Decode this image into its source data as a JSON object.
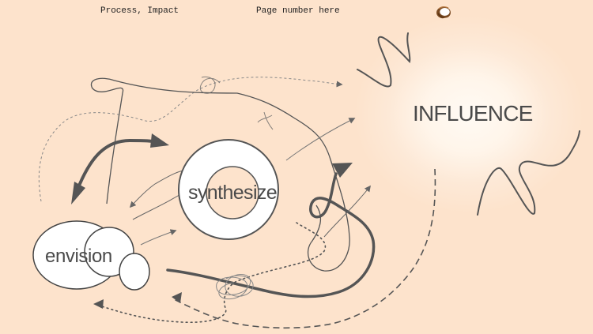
{
  "header": {
    "left_text": "Process, Impact",
    "page_number_text": "Page number here"
  },
  "icons": {
    "top_right": "coconut-icon"
  },
  "diagram": {
    "nodes": {
      "envision": "envision",
      "synthesize": "synthesize",
      "influence": "INFLUENCE"
    }
  },
  "colors": {
    "background": "#fde3cc",
    "stroke": "#555555",
    "influence_core": "#fffaf4",
    "node_fill": "#ffffff"
  }
}
